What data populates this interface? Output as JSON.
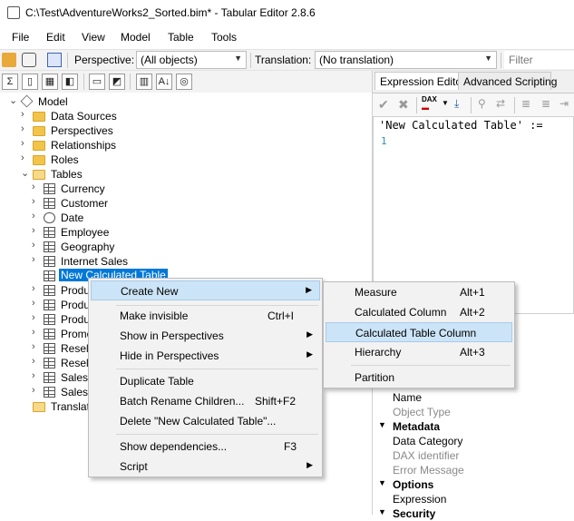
{
  "window": {
    "title": "C:\\Test\\AdventureWorks2_Sorted.bim* - Tabular Editor 2.8.6"
  },
  "menu": [
    "File",
    "Edit",
    "View",
    "Model",
    "Table",
    "Tools"
  ],
  "toolbar": {
    "perspective_label": "Perspective:",
    "perspective_value": "(All objects)",
    "translation_label": "Translation:",
    "translation_value": "(No translation)",
    "filter_placeholder": "Filter"
  },
  "tree": {
    "root": "Model",
    "folders": [
      "Data Sources",
      "Perspectives",
      "Relationships",
      "Roles",
      "Tables"
    ],
    "tables": [
      "Currency",
      "Customer",
      "Date",
      "Employee",
      "Geography",
      "Internet Sales",
      "New Calculated Table",
      "Produ",
      "Produ",
      "Produ",
      "Promo",
      "Resell",
      "Resell",
      "Sales",
      "Sales"
    ],
    "translations": "Translati"
  },
  "right": {
    "tabs": [
      "Expression Editor",
      "Advanced Scripting"
    ],
    "dax_label": "DAX",
    "code_line": "'New Calculated Table' :=",
    "line_number": "1"
  },
  "properties": [
    {
      "key": "Name",
      "kind": "item"
    },
    {
      "key": "Object Type",
      "kind": "grey"
    },
    {
      "key": "Metadata",
      "kind": "cat"
    },
    {
      "key": "Data Category",
      "kind": "item"
    },
    {
      "key": "DAX identifier",
      "kind": "grey"
    },
    {
      "key": "Error Message",
      "kind": "grey"
    },
    {
      "key": "Options",
      "kind": "cat"
    },
    {
      "key": "Expression",
      "kind": "item"
    },
    {
      "key": "Security",
      "kind": "cat"
    }
  ],
  "context_menu": {
    "items": [
      {
        "label": "Create New",
        "shortcut": "",
        "submenu": true,
        "highlight": true
      },
      {
        "sep": true
      },
      {
        "label": "Make invisible",
        "shortcut": "Ctrl+I"
      },
      {
        "label": "Show in Perspectives",
        "shortcut": "",
        "submenu": true
      },
      {
        "label": "Hide in Perspectives",
        "shortcut": "",
        "submenu": true
      },
      {
        "sep": true
      },
      {
        "label": "Duplicate Table",
        "shortcut": ""
      },
      {
        "label": "Batch Rename Children...",
        "shortcut": "Shift+F2"
      },
      {
        "label": "Delete \"New Calculated Table\"...",
        "shortcut": ""
      },
      {
        "sep": true
      },
      {
        "label": "Show dependencies...",
        "shortcut": "F3"
      },
      {
        "label": "Script",
        "shortcut": "",
        "submenu": true
      }
    ]
  },
  "submenu": {
    "items": [
      {
        "label": "Measure",
        "shortcut": "Alt+1"
      },
      {
        "label": "Calculated Column",
        "shortcut": "Alt+2"
      },
      {
        "label": "Calculated Table Column",
        "shortcut": "",
        "highlight": true
      },
      {
        "label": "Hierarchy",
        "shortcut": "Alt+3"
      },
      {
        "sep": true
      },
      {
        "label": "Partition",
        "shortcut": ""
      }
    ]
  }
}
